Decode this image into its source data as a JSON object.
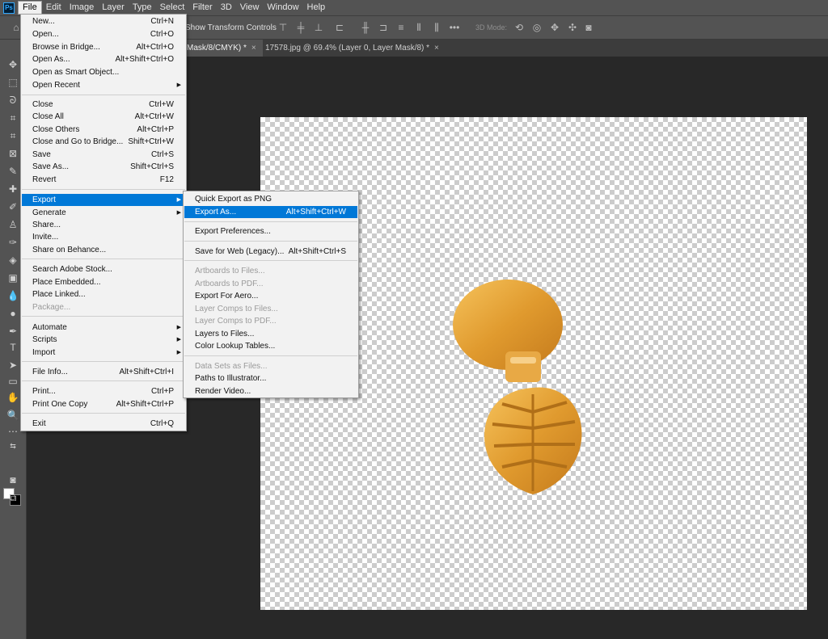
{
  "menubar": {
    "logo": "Ps",
    "items": [
      "File",
      "Edit",
      "Image",
      "Layer",
      "Type",
      "Select",
      "Filter",
      "3D",
      "View",
      "Window",
      "Help"
    ]
  },
  "options": {
    "show_transform": "Show Transform Controls",
    "more": "•••",
    "mode_3d": "3D Mode:"
  },
  "tabs": [
    {
      "label": "Mask/8/CMYK) *",
      "close": "×"
    },
    {
      "label": "17578.jpg @ 69.4% (Layer 0, Layer Mask/8) *",
      "close": "×"
    }
  ],
  "file_menu": {
    "items": [
      {
        "label": "New...",
        "shortcut": "Ctrl+N"
      },
      {
        "label": "Open...",
        "shortcut": "Ctrl+O"
      },
      {
        "label": "Browse in Bridge...",
        "shortcut": "Alt+Ctrl+O"
      },
      {
        "label": "Open As...",
        "shortcut": "Alt+Shift+Ctrl+O"
      },
      {
        "label": "Open as Smart Object...",
        "shortcut": ""
      },
      {
        "label": "Open Recent",
        "shortcut": ""
      },
      {
        "label": "Close",
        "shortcut": "Ctrl+W"
      },
      {
        "label": "Close All",
        "shortcut": "Alt+Ctrl+W"
      },
      {
        "label": "Close Others",
        "shortcut": "Alt+Ctrl+P"
      },
      {
        "label": "Close and Go to Bridge...",
        "shortcut": "Shift+Ctrl+W"
      },
      {
        "label": "Save",
        "shortcut": "Ctrl+S"
      },
      {
        "label": "Save As...",
        "shortcut": "Shift+Ctrl+S"
      },
      {
        "label": "Revert",
        "shortcut": "F12"
      },
      {
        "label": "Export",
        "shortcut": ""
      },
      {
        "label": "Generate",
        "shortcut": ""
      },
      {
        "label": "Share...",
        "shortcut": ""
      },
      {
        "label": "Invite...",
        "shortcut": ""
      },
      {
        "label": "Share on Behance...",
        "shortcut": ""
      },
      {
        "label": "Search Adobe Stock...",
        "shortcut": ""
      },
      {
        "label": "Place Embedded...",
        "shortcut": ""
      },
      {
        "label": "Place Linked...",
        "shortcut": ""
      },
      {
        "label": "Package...",
        "shortcut": ""
      },
      {
        "label": "Automate",
        "shortcut": ""
      },
      {
        "label": "Scripts",
        "shortcut": ""
      },
      {
        "label": "Import",
        "shortcut": ""
      },
      {
        "label": "File Info...",
        "shortcut": "Alt+Shift+Ctrl+I"
      },
      {
        "label": "Print...",
        "shortcut": "Ctrl+P"
      },
      {
        "label": "Print One Copy",
        "shortcut": "Alt+Shift+Ctrl+P"
      },
      {
        "label": "Exit",
        "shortcut": "Ctrl+Q"
      }
    ]
  },
  "export_menu": {
    "items": [
      {
        "label": "Quick Export as PNG",
        "shortcut": ""
      },
      {
        "label": "Export As...",
        "shortcut": "Alt+Shift+Ctrl+W"
      },
      {
        "label": "Export Preferences...",
        "shortcut": ""
      },
      {
        "label": "Save for Web (Legacy)...",
        "shortcut": "Alt+Shift+Ctrl+S"
      },
      {
        "label": "Artboards to Files...",
        "shortcut": ""
      },
      {
        "label": "Artboards to PDF...",
        "shortcut": ""
      },
      {
        "label": "Export For Aero...",
        "shortcut": ""
      },
      {
        "label": "Layer Comps to Files...",
        "shortcut": ""
      },
      {
        "label": "Layer Comps to PDF...",
        "shortcut": ""
      },
      {
        "label": "Layers to Files...",
        "shortcut": ""
      },
      {
        "label": "Color Lookup Tables...",
        "shortcut": ""
      },
      {
        "label": "Data Sets as Files...",
        "shortcut": ""
      },
      {
        "label": "Paths to Illustrator...",
        "shortcut": ""
      },
      {
        "label": "Render Video...",
        "shortcut": ""
      }
    ]
  },
  "colors": {
    "highlight": "#0078d7",
    "menu_bg": "#f2f2f2",
    "app_bg": "#282828",
    "panel_bg": "#535353",
    "gold": "#e3a43a"
  }
}
